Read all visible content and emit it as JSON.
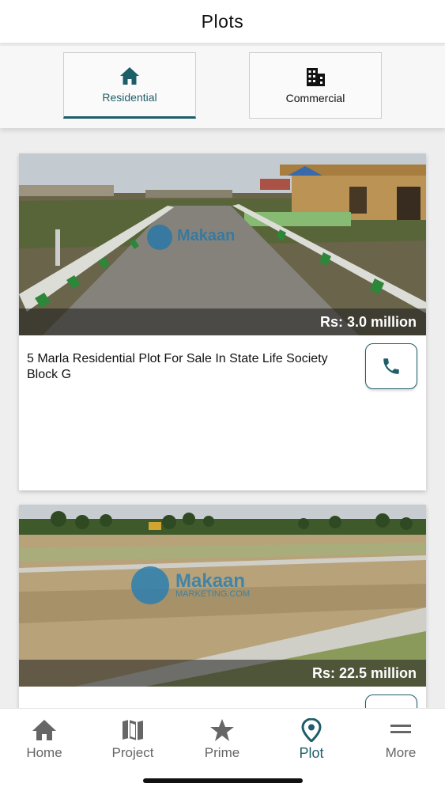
{
  "header": {
    "title": "Plots"
  },
  "tabs": [
    {
      "label": "Residential",
      "icon": "home-icon",
      "active": true
    },
    {
      "label": "Commercial",
      "icon": "building-icon",
      "active": false
    }
  ],
  "listings": [
    {
      "title": "5 Marla Residential Plot For Sale In State Life Society Block G",
      "price": "Rs: 3.0 million",
      "watermark": "Makaan"
    },
    {
      "title": "",
      "price": "Rs: 22.5 million",
      "watermark": "Makaan",
      "watermark_sub": "MARKETING.COM"
    }
  ],
  "bottom_nav": [
    {
      "label": "Home",
      "icon": "home-icon"
    },
    {
      "label": "Project",
      "icon": "map-icon"
    },
    {
      "label": "Prime",
      "icon": "star-icon"
    },
    {
      "label": "Plot",
      "icon": "location-pin-icon",
      "active": true
    },
    {
      "label": "More",
      "icon": "menu-icon"
    }
  ],
  "colors": {
    "accent": "#1e5e69",
    "inactive": "#666666"
  }
}
